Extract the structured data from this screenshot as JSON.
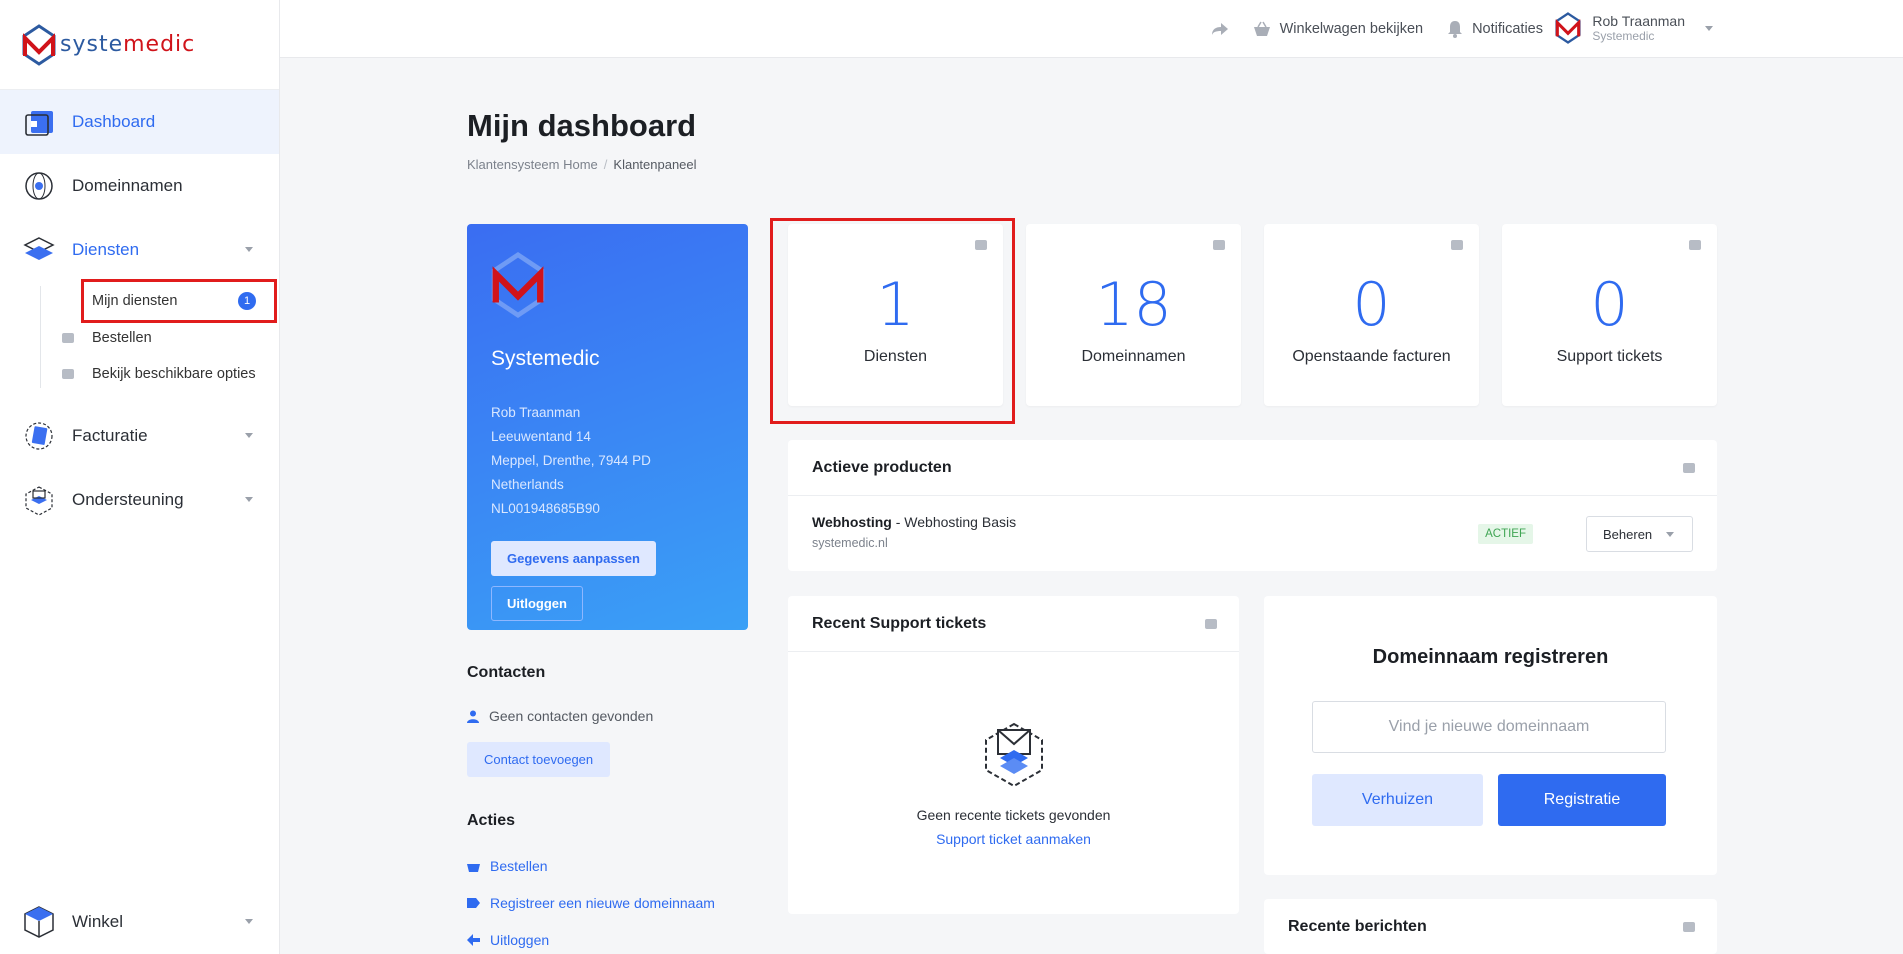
{
  "brand": {
    "logo_part1": "syste",
    "logo_part2": "medic",
    "color_primary": "#2f6bf0",
    "color_highlight": "#e11c1c"
  },
  "sidebar": {
    "items": [
      {
        "label": "Dashboard",
        "icon": "dashboard-icon"
      },
      {
        "label": "Domeinnamen",
        "icon": "globe-icon"
      },
      {
        "label": "Diensten",
        "icon": "layers-icon"
      },
      {
        "label": "Facturatie",
        "icon": "invoice-icon"
      },
      {
        "label": "Ondersteuning",
        "icon": "support-icon"
      }
    ],
    "sub": [
      {
        "label": "Mijn diensten",
        "badge": "1"
      },
      {
        "label": "Bestellen"
      },
      {
        "label": "Bekijk beschikbare opties"
      }
    ],
    "bottom": {
      "label": "Winkel",
      "icon": "box-icon"
    }
  },
  "topbar": {
    "cart": "Winkelwagen bekijken",
    "notifications": "Notificaties",
    "user_name": "Rob Traanman",
    "user_org": "Systemedic"
  },
  "page": {
    "title": "Mijn dashboard",
    "crumb_home": "Klantensysteem Home",
    "crumb_sep": "/",
    "crumb_current": "Klantenpaneel"
  },
  "profile": {
    "company": "Systemedic",
    "name": "Rob Traanman",
    "street": "Leeuwentand 14",
    "city": "Meppel, Drenthe, 7944 PD",
    "country": "Netherlands",
    "vat": "NL001948685B90",
    "edit_label": "Gegevens aanpassen",
    "logout_label": "Uitloggen"
  },
  "contacts": {
    "title": "Contacten",
    "empty": "Geen contacten gevonden",
    "add_label": "Contact toevoegen"
  },
  "actions": {
    "title": "Acties",
    "order": "Bestellen",
    "register_domain": "Registreer een nieuwe domeinnaam",
    "logout": "Uitloggen"
  },
  "stats": [
    {
      "value": "1",
      "label": "Diensten"
    },
    {
      "value": "18",
      "label": "Domeinnamen"
    },
    {
      "value": "0",
      "label": "Openstaande facturen"
    },
    {
      "value": "0",
      "label": "Support tickets"
    }
  ],
  "products": {
    "title": "Actieve producten",
    "item_name": "Webhosting",
    "item_plan": " - Webhosting Basis",
    "item_domain": "systemedic.nl",
    "status": "ACTIEF",
    "manage_label": "Beheren"
  },
  "tickets": {
    "title": "Recent Support tickets",
    "empty": "Geen recente tickets gevonden",
    "create_link": "Support ticket aanmaken"
  },
  "domain": {
    "title": "Domeinnaam registreren",
    "placeholder": "Vind je nieuwe domeinnaam",
    "transfer_label": "Verhuizen",
    "register_label": "Registratie"
  },
  "messages": {
    "title": "Recente berichten"
  }
}
